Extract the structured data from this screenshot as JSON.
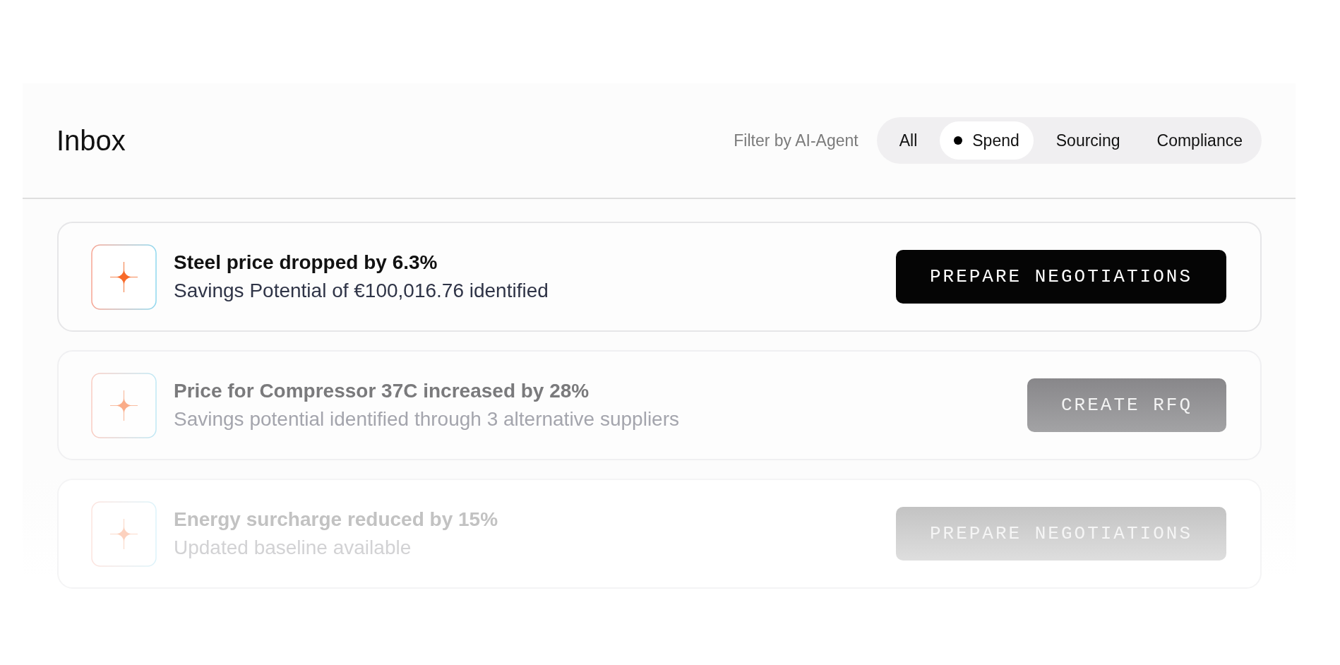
{
  "header": {
    "title": "Inbox",
    "filter_label": "Filter by AI-Agent",
    "filters": [
      {
        "label": "All",
        "selected": false
      },
      {
        "label": "Spend",
        "selected": true
      },
      {
        "label": "Sourcing",
        "selected": false
      },
      {
        "label": "Compliance",
        "selected": false
      }
    ]
  },
  "items": [
    {
      "kind": "active",
      "title": "Steel price dropped by 6.3%",
      "subtitle": "Savings Potential of €100,016.76 identified",
      "action": "PREPARE NEGOTIATIONS"
    },
    {
      "kind": "muted",
      "title": "Price for Compressor 37C increased by 28%",
      "subtitle": "Savings potential identified through 3 alternative suppliers",
      "action": "CREATE RFQ"
    },
    {
      "kind": "faint",
      "title": "Energy surcharge reduced by 15%",
      "subtitle": "Updated baseline available",
      "action": "PREPARE NEGOTIATIONS"
    }
  ]
}
